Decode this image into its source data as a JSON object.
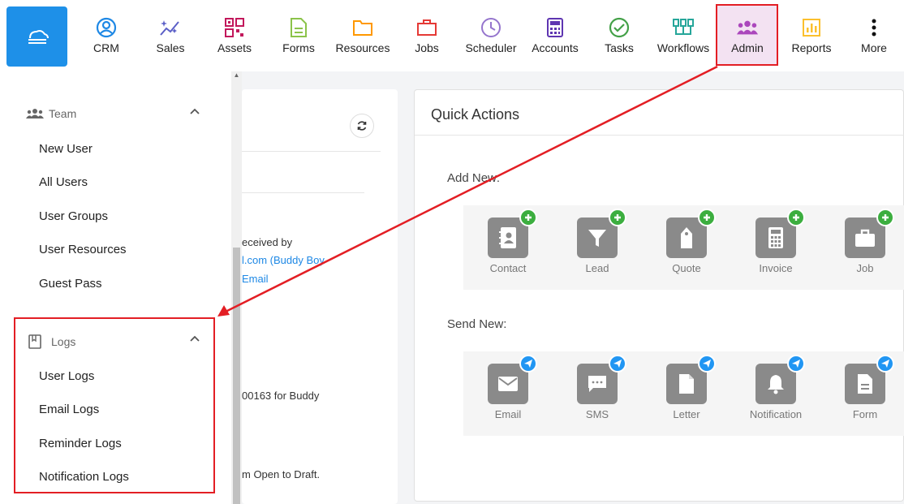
{
  "nav": {
    "logo_icon": "cloud-icon",
    "items": [
      {
        "label": "CRM",
        "icon": "user-circle-icon",
        "color": "#1e88e5"
      },
      {
        "label": "Sales",
        "icon": "sparkle-chart-icon",
        "color": "#5b5fc7"
      },
      {
        "label": "Assets",
        "icon": "qr-code-icon",
        "color": "#c2185b"
      },
      {
        "label": "Forms",
        "icon": "document-icon",
        "color": "#8bc34a"
      },
      {
        "label": "Resources",
        "icon": "folder-icon",
        "color": "#ff9800"
      },
      {
        "label": "Jobs",
        "icon": "briefcase-icon",
        "color": "#e53935"
      },
      {
        "label": "Scheduler",
        "icon": "clock-icon",
        "color": "#9575cd"
      },
      {
        "label": "Accounts",
        "icon": "calculator-icon",
        "color": "#5e35b1"
      },
      {
        "label": "Tasks",
        "icon": "check-circle-icon",
        "color": "#43a047"
      },
      {
        "label": "Workflows",
        "icon": "workflow-icon",
        "color": "#26a69a"
      },
      {
        "label": "Admin",
        "icon": "team-icon",
        "color": "#ab47bc"
      },
      {
        "label": "Reports",
        "icon": "bar-chart-icon",
        "color": "#fbc02d"
      },
      {
        "label": "More",
        "icon": "more-vertical-icon",
        "color": "#111111"
      }
    ]
  },
  "sidebar": {
    "team": {
      "title": "Team",
      "items": [
        "New User",
        "All Users",
        "User Groups",
        "User Resources",
        "Guest Pass"
      ]
    },
    "logs": {
      "title": "Logs",
      "items": [
        "User Logs",
        "Email Logs",
        "Reminder Logs",
        "Notification Logs"
      ]
    }
  },
  "activity": {
    "line1": "eceived by",
    "line2a": "l.com (",
    "line2b": "Buddy Boy",
    "line3": "Email",
    "line4": "00163 for Buddy",
    "line5": "m Open to Draft."
  },
  "quick_actions": {
    "title": "Quick Actions",
    "add_label": "Add New:",
    "send_label": "Send New:",
    "add_items": [
      {
        "label": "Contact",
        "icon": "contact-book-icon"
      },
      {
        "label": "Lead",
        "icon": "funnel-icon"
      },
      {
        "label": "Quote",
        "icon": "tag-icon"
      },
      {
        "label": "Invoice",
        "icon": "calculator-icon"
      },
      {
        "label": "Job",
        "icon": "briefcase-icon"
      }
    ],
    "send_items": [
      {
        "label": "Email",
        "icon": "envelope-icon"
      },
      {
        "label": "SMS",
        "icon": "chat-bubble-icon"
      },
      {
        "label": "Letter",
        "icon": "page-icon"
      },
      {
        "label": "Notification",
        "icon": "bell-icon"
      },
      {
        "label": "Form",
        "icon": "form-icon"
      }
    ]
  },
  "colors": {
    "brand": "#1e90e8",
    "highlight": "#e31e24",
    "tile": "#8a8a8a",
    "add_badge": "#3cae3f",
    "send_badge": "#2196f3"
  }
}
